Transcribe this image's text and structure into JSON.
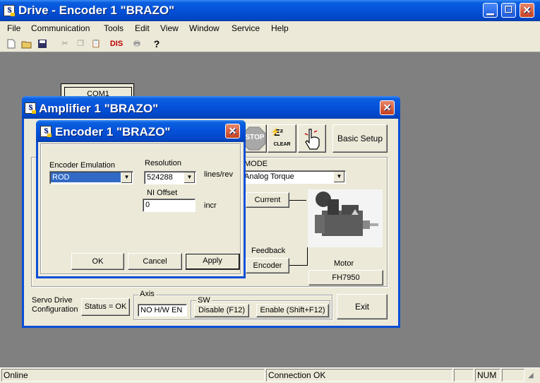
{
  "main_window": {
    "title": "Drive - Encoder 1 \"BRAZO\"",
    "icon_letter": "S"
  },
  "menu": [
    {
      "label": "File"
    },
    {
      "label": "Communication"
    },
    {
      "label": "Tools"
    },
    {
      "label": "Edit"
    },
    {
      "label": "View"
    },
    {
      "label": "Window"
    },
    {
      "label": "Service"
    },
    {
      "label": "Help"
    }
  ],
  "toolbar": {
    "dis_label": "DIS",
    "help_glyph": "?"
  },
  "background_window": {
    "title": "COM1"
  },
  "amplifier_window": {
    "title": "Amplifier 1 \"BRAZO\"",
    "stop_label": "STOP",
    "e2_label": "E²",
    "e2_clear_label": "CLEAR",
    "basic_setup_label": "Basic Setup",
    "mode_label": "MODE",
    "mode_value": "Analog Torque",
    "current_label": "Current",
    "feedback_label": "Feedback",
    "encoder_button_label": "Encoder",
    "motor_label": "Motor",
    "motor_value": "FH7950",
    "servo_config_line1": "Servo Drive",
    "servo_config_line2": "Configuration",
    "status_label": "Status = OK",
    "axis_label": "Axis",
    "axis_value": "NO H/W EN",
    "sw_label": "SW",
    "disable_label": "Disable (F12)",
    "enable_label": "Enable (Shift+F12)",
    "exit_label": "Exit"
  },
  "encoder_dialog": {
    "title": "Encoder 1 \"BRAZO\"",
    "emulation_label": "Encoder Emulation",
    "emulation_value": "ROD",
    "resolution_label": "Resolution",
    "resolution_value": "524288",
    "resolution_unit": "lines/rev",
    "ni_offset_label": "NI Offset",
    "ni_offset_value": "0",
    "ni_offset_unit": "incr",
    "ok_label": "OK",
    "cancel_label": "Cancel",
    "apply_label": "Apply"
  },
  "statusbar": {
    "left": "Online",
    "middle": "Connection OK",
    "num": "NUM"
  }
}
